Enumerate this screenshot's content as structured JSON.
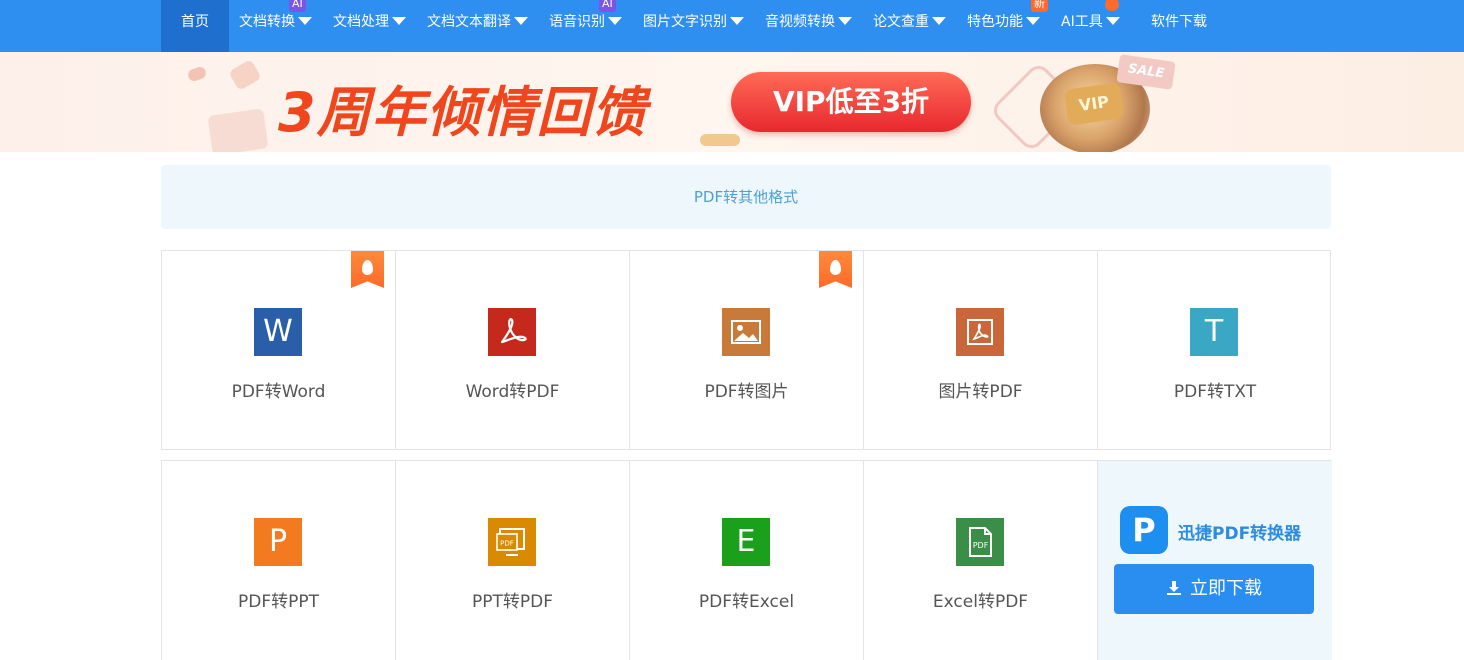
{
  "nav": {
    "items": [
      {
        "label": "首页"
      },
      {
        "label": "文档转换",
        "badge": "AI"
      },
      {
        "label": "文档处理"
      },
      {
        "label": "文档文本翻译"
      },
      {
        "label": "语音识别",
        "badge": "AI"
      },
      {
        "label": "图片文字识别"
      },
      {
        "label": "音视频转换"
      },
      {
        "label": "论文查重"
      },
      {
        "label": "特色功能",
        "badge": "新"
      },
      {
        "label": "AI工具"
      },
      {
        "label": "软件下载"
      }
    ]
  },
  "banner": {
    "title": "3周年倾情回馈",
    "pill": "VIP低至3折",
    "coin_text": "VIP",
    "sale_text": "SALE"
  },
  "section": {
    "title": "PDF转其他格式"
  },
  "tools_row1": [
    {
      "label": "PDF转Word",
      "icon_char": "W",
      "color": "#2b5ea8",
      "hot": true
    },
    {
      "label": "Word转PDF",
      "icon_char": "",
      "color": "#c5291c",
      "hot": false
    },
    {
      "label": "PDF转图片",
      "icon_char": "",
      "color": "#c87a3a",
      "hot": true
    },
    {
      "label": "图片转PDF",
      "icon_char": "",
      "color": "#c9663a",
      "hot": false
    },
    {
      "label": "PDF转TXT",
      "icon_char": "T",
      "color": "#3aa8c4",
      "hot": false
    }
  ],
  "tools_row2": [
    {
      "label": "PDF转PPT",
      "icon_char": "P",
      "color": "#f47a20"
    },
    {
      "label": "PPT转PDF",
      "icon_char": "PDF",
      "color": "#d98a00"
    },
    {
      "label": "PDF转Excel",
      "icon_char": "E",
      "color": "#1aa01a"
    },
    {
      "label": "Excel转PDF",
      "icon_char": "PDF",
      "color": "#3a8e48"
    }
  ],
  "promo": {
    "logo_char": "P",
    "name": "迅捷PDF转换器",
    "download_label": "立即下载"
  }
}
